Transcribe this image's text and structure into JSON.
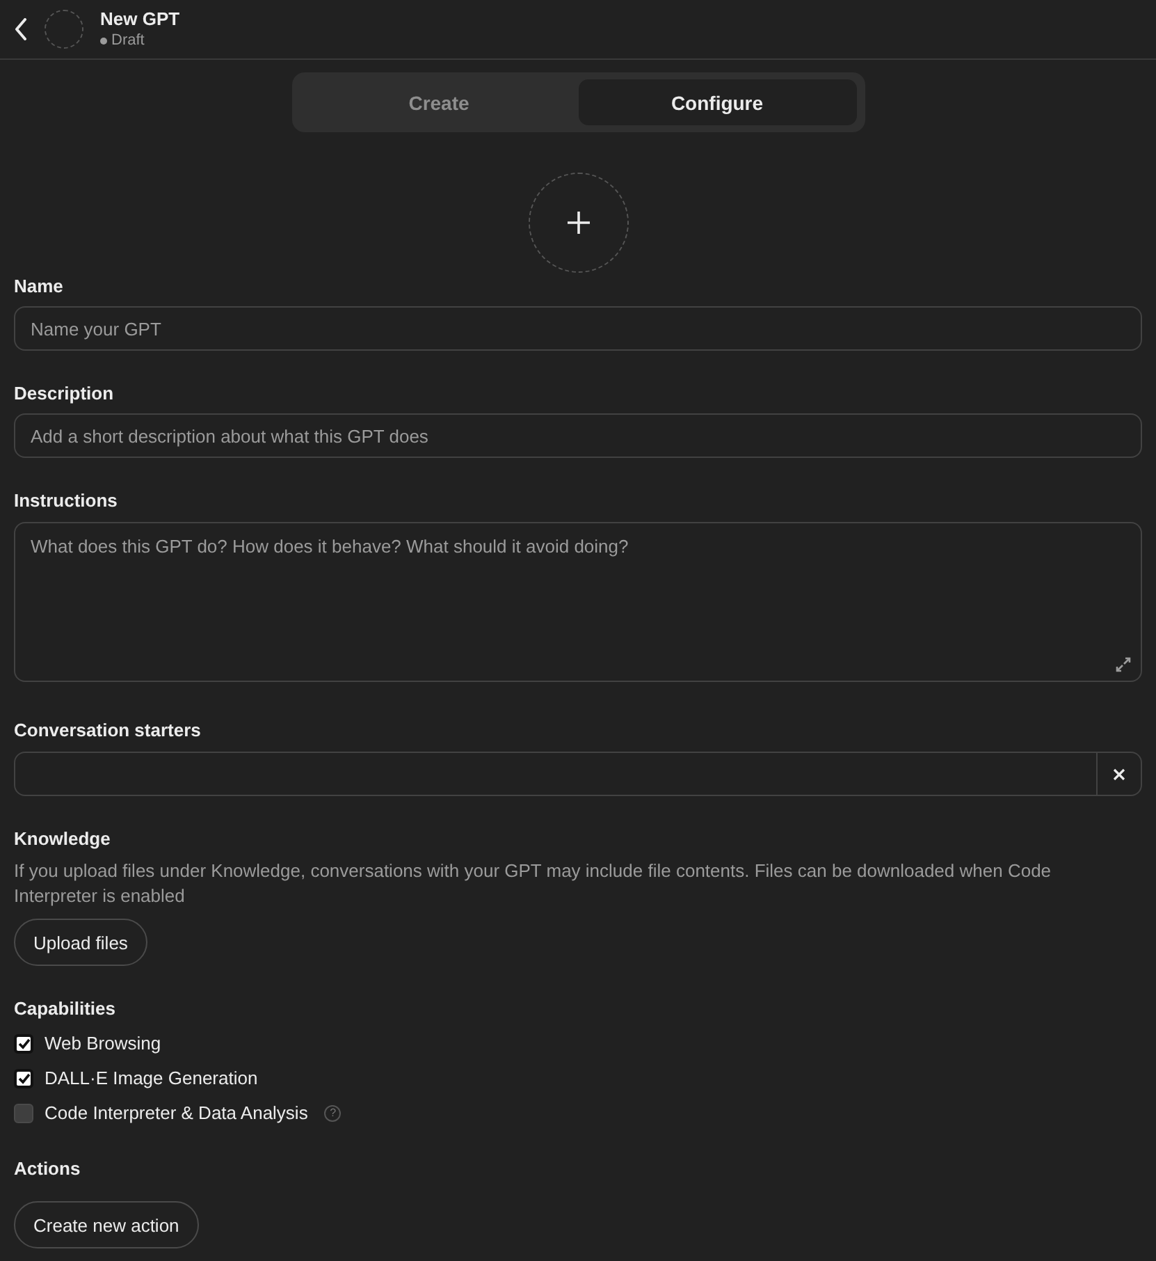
{
  "header": {
    "title": "New GPT",
    "status": "Draft"
  },
  "tabs": [
    {
      "label": "Create",
      "selected": false
    },
    {
      "label": "Configure",
      "selected": true
    }
  ],
  "fields": [
    {
      "kind": "input",
      "label": "Name",
      "placeholder": "Name your GPT"
    },
    {
      "kind": "input",
      "label": "Description",
      "placeholder": "Add a short description about what this GPT does"
    },
    {
      "kind": "textarea",
      "label": "Instructions",
      "placeholder": "What does this GPT do? How does it behave? What should it avoid doing?"
    },
    {
      "kind": "starter",
      "label": "Conversation starters"
    }
  ],
  "knowledge": {
    "title": "Knowledge",
    "description": "If you upload files under Knowledge, conversations with your GPT may include file contents. Files can be downloaded when Code Interpreter is enabled",
    "button": "Upload files"
  },
  "capabilities": {
    "title": "Capabilities",
    "items": [
      {
        "label": "Web Browsing",
        "checked": true
      },
      {
        "label": "DALL·E Image Generation",
        "checked": true
      },
      {
        "label": "Code Interpreter & Data Analysis",
        "checked": false,
        "help": "?"
      }
    ]
  },
  "actions": {
    "title": "Actions",
    "button": "Create new action"
  }
}
